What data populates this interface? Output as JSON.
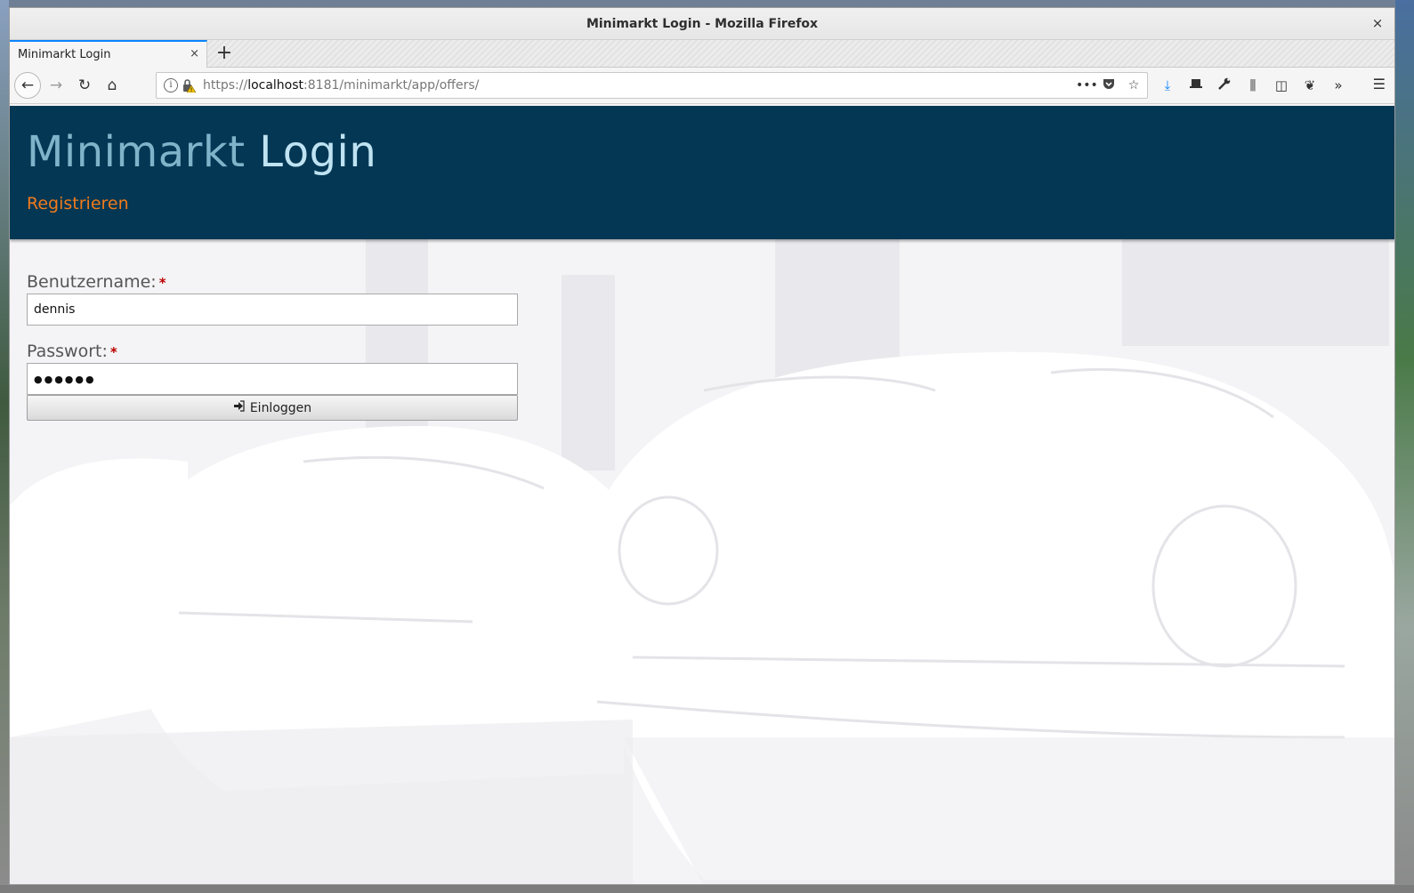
{
  "window": {
    "title": "Minimarkt Login - Mozilla Firefox",
    "close_glyph": "×"
  },
  "tabs": [
    {
      "label": "Minimarkt Login",
      "close_glyph": "×"
    }
  ],
  "new_tab_glyph": "+",
  "navbar": {
    "back_glyph": "←",
    "forward_glyph": "→",
    "reload_glyph": "↻",
    "home_glyph": "⌂",
    "url": {
      "protocol": "https://",
      "host": "localhost",
      "rest": ":8181/minimarkt/app/offers/"
    },
    "info_glyph": "i",
    "page_actions": [
      {
        "name": "page-actions-menu-icon",
        "glyph": "•••"
      },
      {
        "name": "pocket-icon",
        "glyph": "⛉"
      },
      {
        "name": "bookmark-star-icon",
        "glyph": "☆"
      }
    ],
    "toolbar": [
      {
        "name": "downloads-icon",
        "glyph": "⤓"
      },
      {
        "name": "laptop-icon",
        "glyph": "▬"
      },
      {
        "name": "wrench-icon",
        "glyph": "🔧"
      },
      {
        "name": "library-icon",
        "glyph": "⫼"
      },
      {
        "name": "sidebar-icon",
        "glyph": "◫"
      },
      {
        "name": "extension-icon",
        "glyph": "❦"
      },
      {
        "name": "overflow-menu-icon",
        "glyph": "»"
      }
    ],
    "menu_glyph": "☰"
  },
  "header": {
    "brand_part1": "Minimarkt",
    "brand_part2": "Login",
    "register_link": "Registrieren"
  },
  "form": {
    "username_label": "Benutzername:",
    "username_value": "dennis",
    "password_label": "Passwort:",
    "password_value": "●●●●●●",
    "required_marker": "*",
    "login_icon": "➜",
    "login_label": "Einloggen"
  },
  "colors": {
    "header_bg": "#033754",
    "brand_light": "#bfe3f2",
    "brand_muted": "#7fb3c9",
    "link_orange": "#f07a1c",
    "required_red": "#bb0000"
  }
}
